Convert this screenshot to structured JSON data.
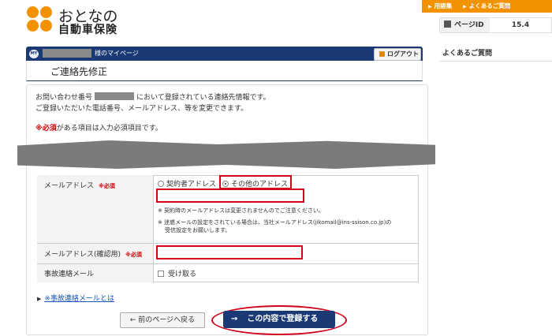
{
  "brand": {
    "line1": "おとなの",
    "line2": "自動車保険",
    "color": "#f39200"
  },
  "topnav": {
    "glossary": "用語集",
    "faq": "よくあるご質問"
  },
  "page_id": {
    "label": "ページID",
    "value": "15.4"
  },
  "side_faq": "よくあるご質問",
  "mypage": {
    "badge": "MY",
    "suffix": "様のマイページ",
    "logout": "ログアウト"
  },
  "page_title": "ご連絡先修正",
  "intro": {
    "pre": "お問い合わせ番号",
    "post": "において登録されている連絡先情報です。",
    "line2": "ご登録いただいた電話番号、メールアドレス、等を変更できます。"
  },
  "required_note": {
    "mark": "※必須",
    "text": "がある項目は入力必須項目です。"
  },
  "form": {
    "required_tag": "※必須",
    "email": {
      "label": "メールアドレス",
      "option_contract": "契約者アドレス",
      "option_other": "その他のアドレス",
      "value": "",
      "note1": "※ 契約時のメールアドレスは変更されませんのでご注意ください。",
      "note2a": "※ 迷惑メールの設定をされている場合は、当社メールアドレス(jikomail@ins-ssison.co.jp)の",
      "note2b": "受信設定をお願いします。"
    },
    "email_confirm": {
      "label": "メールアドレス(確認用)",
      "value": ""
    },
    "accident_mail": {
      "label": "事故連絡メール",
      "checkbox_label": "受け取る"
    }
  },
  "link": {
    "text": "※事故連絡メールとは"
  },
  "buttons": {
    "back": "← 前のページへ戻る",
    "arrow": "→",
    "submit": "この内容で登録する"
  },
  "colors": {
    "navy": "#1b3a75",
    "orange": "#f39200",
    "highlight_red": "#d0021b"
  }
}
